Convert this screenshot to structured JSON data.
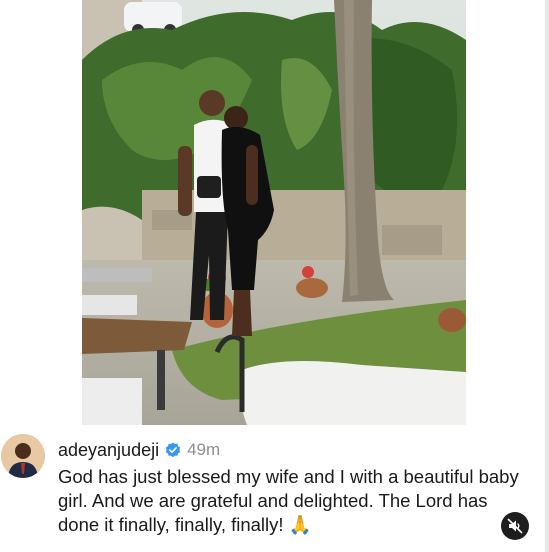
{
  "post": {
    "username": "adeyanjudeji",
    "time_ago": "49m",
    "caption_text": "God has just blessed my wife and I with a beautiful baby girl. And we are grateful and delighted. The Lord has done it finally, finally, finally! ",
    "caption_emoji": "🙏"
  },
  "icons": {
    "verified": "verified-badge-icon",
    "mute": "muted-speaker-icon"
  },
  "colors": {
    "verified_blue": "#3897f0",
    "timestamp_gray": "#8e8e8e",
    "text": "#1a1a1a",
    "mute_button_bg": "#1e1e1e"
  }
}
